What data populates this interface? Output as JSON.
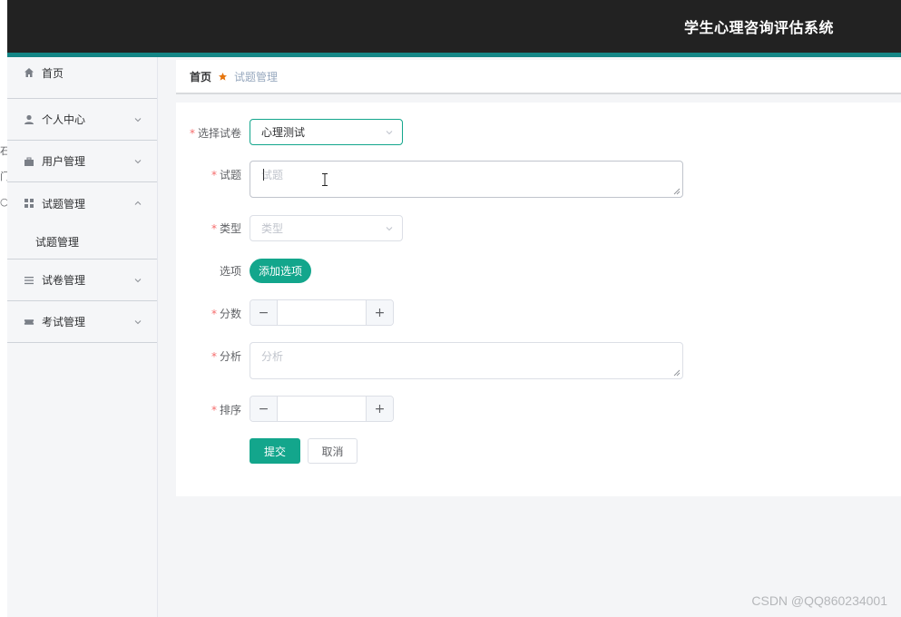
{
  "left_fragments": [
    "石",
    "门",
    "○"
  ],
  "header": {
    "title": "学生心理咨询评估系统"
  },
  "sidebar": {
    "items": [
      {
        "label": "首页",
        "icon": "home-icon"
      },
      {
        "label": "个人中心",
        "icon": "user-icon"
      },
      {
        "label": "用户管理",
        "icon": "briefcase-icon"
      },
      {
        "label": "试题管理",
        "icon": "grid-icon",
        "expanded": true,
        "children": [
          {
            "label": "试题管理"
          }
        ]
      },
      {
        "label": "试卷管理",
        "icon": "list-icon"
      },
      {
        "label": "考试管理",
        "icon": "ticket-icon"
      }
    ]
  },
  "breadcrumb": {
    "home": "首页",
    "current": "试题管理"
  },
  "form": {
    "paper": {
      "label": "选择试卷",
      "value": "心理测试"
    },
    "question": {
      "label": "试题",
      "placeholder": "试题",
      "value": ""
    },
    "type": {
      "label": "类型",
      "placeholder": "类型"
    },
    "options": {
      "label": "选项",
      "add_label": "添加选项"
    },
    "score": {
      "label": "分数",
      "value": ""
    },
    "analysis": {
      "label": "分析",
      "placeholder": "分析"
    },
    "order": {
      "label": "排序",
      "value": ""
    },
    "submit_label": "提交",
    "cancel_label": "取消",
    "required_mark": "*",
    "minus": "−",
    "plus": "+"
  },
  "watermark": "CSDN @QQ860234001",
  "colors": {
    "accent": "#13a68c",
    "header_bg": "#222222",
    "header_stripe": "#138585",
    "required": "#f56c6c",
    "breadcrumb_sep": "#e6750d"
  }
}
